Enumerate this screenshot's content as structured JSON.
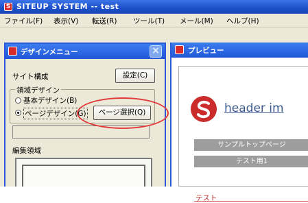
{
  "window": {
    "title": "SITEUP SYSTEM -- test",
    "app_icon": "S"
  },
  "menubar": [
    {
      "label": "ファイル(F)"
    },
    {
      "label": "表示(V)"
    },
    {
      "label": "転送(R)"
    },
    {
      "label": "ツール(T)"
    },
    {
      "label": "メール(M)"
    },
    {
      "label": "ヘルプ(H)"
    }
  ],
  "design_panel": {
    "title": "デザインメニュー",
    "site_structure_label": "サイト構成",
    "settings_button": "設定(C)",
    "area_design_label": "領域デザイン",
    "radio_basic": "基本デザイン(B)",
    "radio_page": "ページデザイン(G)",
    "page_select_button": "ページ選択(Q)",
    "edit_area_label": "編集領域"
  },
  "preview": {
    "title": "プレビュー",
    "header_text": "header im",
    "nav_items": [
      "サンプルトップページ",
      "テスト用1"
    ],
    "link_text": "テスト"
  },
  "colors": {
    "titlebar": "#1c4fc9",
    "panel_border": "#2a5ad8",
    "highlight_ellipse": "#e23a3a",
    "logo_red": "#cc2b2b"
  }
}
